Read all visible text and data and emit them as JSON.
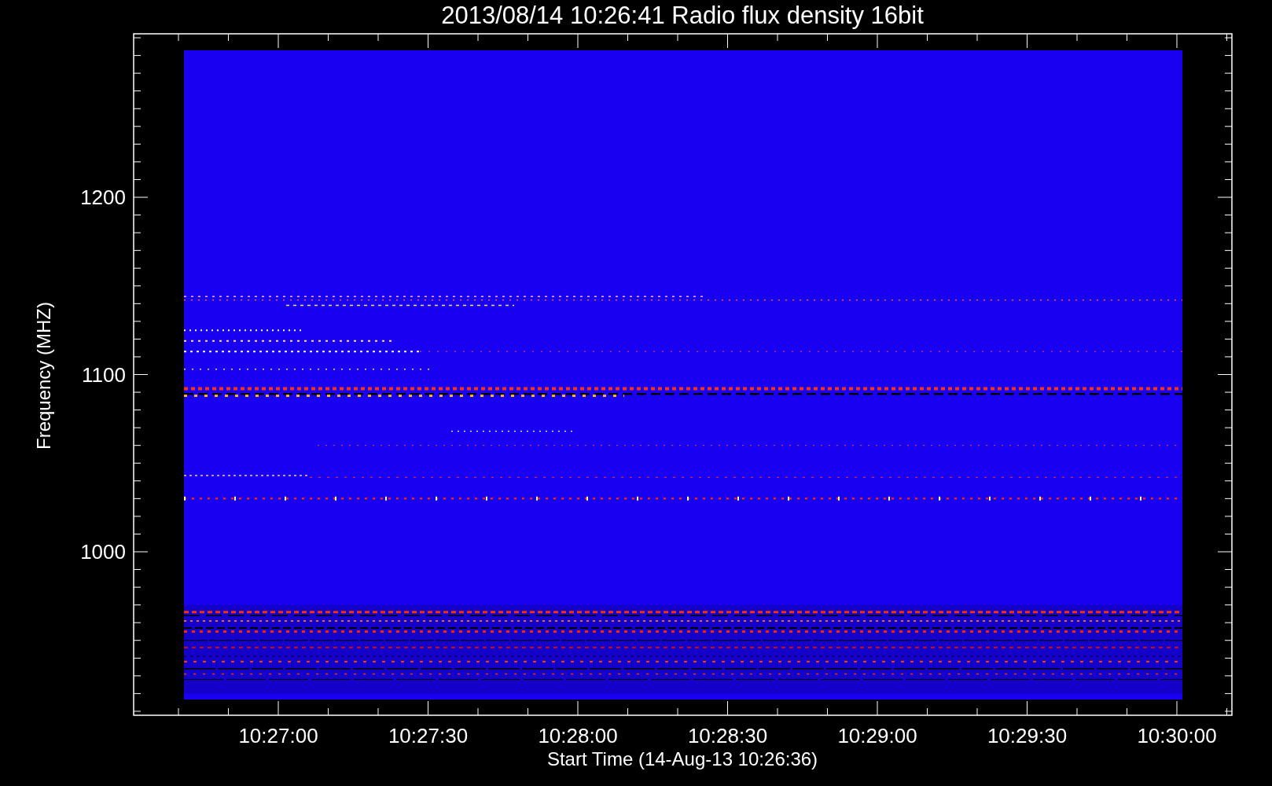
{
  "plot": {
    "title": "2013/08/14 10:26:41 Radio flux density 16bit",
    "xlabel": "Start Time (14-Aug-13 10:26:36)",
    "ylabel": "Frequency (MHZ)",
    "x_tick_labels": [
      "10:27:00",
      "10:27:30",
      "10:28:00",
      "10:28:30",
      "10:29:00",
      "10:29:30",
      "10:30:00"
    ],
    "y_tick_labels": [
      "1200",
      "1100",
      "1000"
    ]
  }
}
